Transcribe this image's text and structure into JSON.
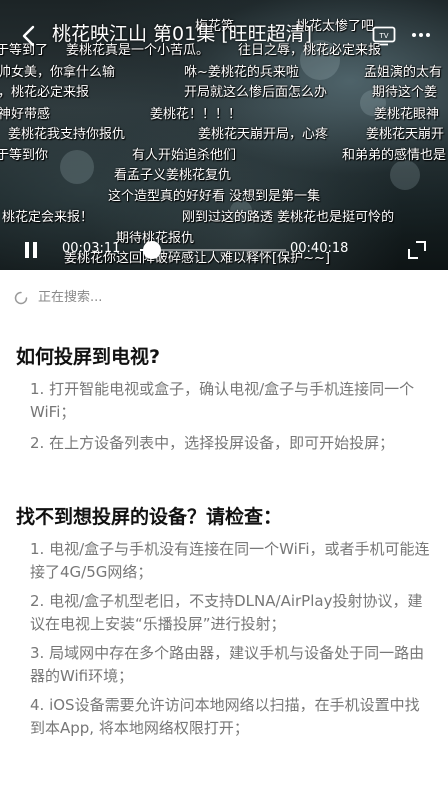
{
  "player": {
    "title": "桃花映江山 第01集 [旺旺超清]",
    "current_time": "00:03:11",
    "total_time": "00:40:18",
    "progress": 0.08,
    "danmaku": [
      "梅花笑",
      "桃花太惨了吧",
      "于等到了",
      "姜桃花真是一个小苦瓜。",
      "往日之辱，桃花必定来报",
      "帅女美，你拿什么输",
      "咻~姜桃花的兵来啦",
      "孟姐演的太有",
      "，桃花必定来报",
      "开局就这么惨后面怎么办",
      "期待这个姜",
      "神好带感",
      "姜桃花！！！！",
      "姜桃花眼神",
      "姜桃花我支持你报仇",
      "姜桃花天崩开局，心疼",
      "姜桃花天崩开",
      "于等到你",
      "有人开始追杀他们",
      "和弟弟的感情也是",
      "看孟子义姜桃花复仇",
      "这个造型真的好好看 没想到是第一集",
      "桃花定会来报！",
      "刚到过这的路透 姜桃花也是挺可怜的",
      "期待桃花报仇",
      "姜桃花你这回降破碎感让人难以释怀[保护~~]"
    ],
    "icons": {
      "back": "back-arrow-icon",
      "cast": "tv-cast-icon",
      "more": "more-dots-icon",
      "pause": "pause-icon",
      "fullscreen": "fullscreen-icon"
    }
  },
  "panel": {
    "searching_text": "正在搜索...",
    "how_to": {
      "title": "如何投屏到电视?",
      "items": [
        "1. 打开智能电视或盒子，确认电视/盒子与手机连接同一个WiFi；",
        "2. 在上方设备列表中，选择投屏设备，即可开始投屏；"
      ]
    },
    "not_found": {
      "title": "找不到想投屏的设备？请检查：",
      "items": [
        "1. 电视/盒子与手机没有连接在同一个WiFi，或者手机可能连接了4G/5G网络；",
        "2. 电视/盒子机型老旧，不支持DLNA/AirPlay投射协议，建议在电视上安装“乐播投屏”进行投射；",
        "3. 局域网中存在多个路由器，建议手机与设备处于同一路由器的Wifi环境；",
        "4. iOS设备需要允许访问本地网络以扫描，在手机设置中找到本App, 将本地网络权限打开；"
      ]
    }
  }
}
